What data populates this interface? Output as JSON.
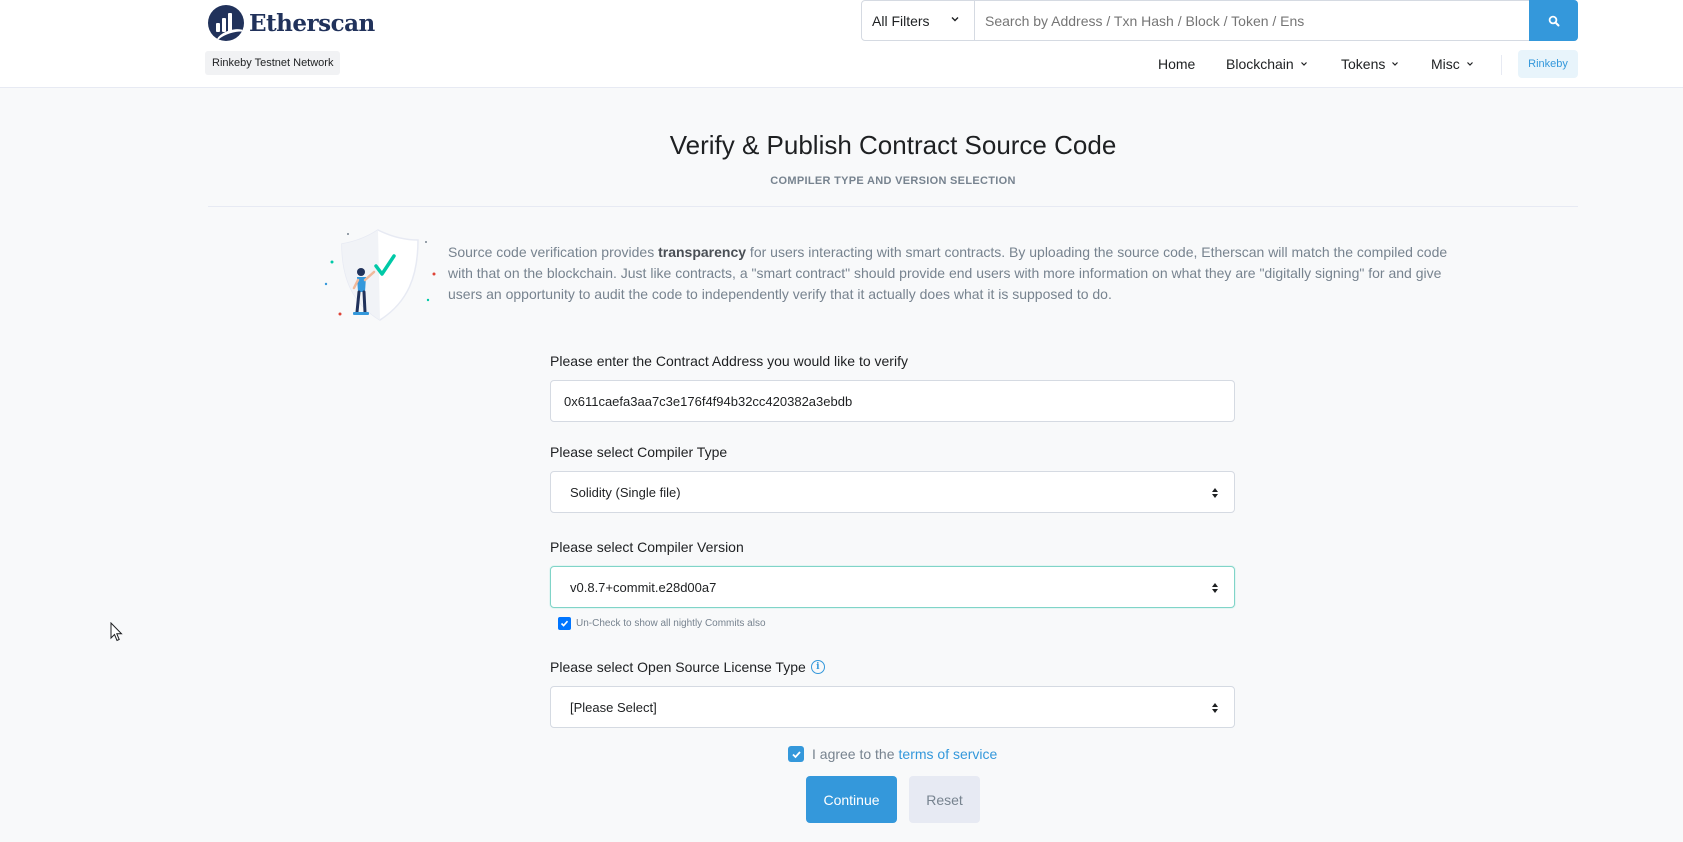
{
  "header": {
    "logo_text": "Etherscan",
    "network_badge": "Rinkeby Testnet Network",
    "search": {
      "filter_label": "All Filters",
      "placeholder": "Search by Address / Txn Hash / Block / Token / Ens"
    },
    "nav": {
      "home": "Home",
      "blockchain": "Blockchain",
      "tokens": "Tokens",
      "misc": "Misc",
      "network": "Rinkeby"
    }
  },
  "page": {
    "title": "Verify & Publish Contract Source Code",
    "subtitle": "COMPILER TYPE AND VERSION SELECTION",
    "intro": {
      "before": "Source code verification provides ",
      "bold": "transparency",
      "after": " for users interacting with smart contracts. By uploading the source code, Etherscan will match the compiled code with that on the blockchain. Just like contracts, a \"smart contract\" should provide end users with more information on what they are \"digitally signing\" for and give users an opportunity to audit the code to independently verify that it actually does what it is supposed to do."
    }
  },
  "form": {
    "address_label": "Please enter the Contract Address you would like to verify",
    "address_value": "0x611caefa3aa7c3e176f4f94b32cc420382a3ebdb",
    "compiler_type_label": "Please select Compiler Type",
    "compiler_type_value": "Solidity (Single file)",
    "compiler_version_label": "Please select Compiler Version",
    "compiler_version_value": "v0.8.7+commit.e28d00a7",
    "nightly_label": "Un-Check to show all nightly Commits also",
    "nightly_checked": true,
    "license_label": "Please select Open Source License Type",
    "license_value": "[Please Select]",
    "agree_text": "I agree to the",
    "terms_link": "terms of service",
    "agree_checked": true,
    "continue_label": "Continue",
    "reset_label": "Reset"
  },
  "colors": {
    "primary": "#3498db",
    "brand_navy": "#21325b",
    "muted": "#77838f",
    "background": "#f8f9fa"
  }
}
